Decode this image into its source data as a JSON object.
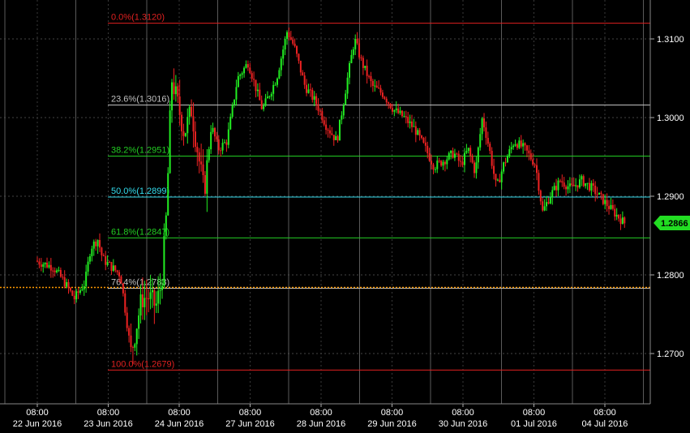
{
  "chart_data": {
    "type": "candlestick",
    "ylim": [
      1.2645,
      1.316
    ],
    "y_ticks": [
      {
        "label": "1.2700",
        "value": 1.27
      },
      {
        "label": "1.2800",
        "value": 1.28
      },
      {
        "label": "1.2900",
        "value": 1.29
      },
      {
        "label": "1.3000",
        "value": 1.3
      },
      {
        "label": "1.3100",
        "value": 1.31
      }
    ],
    "x_ticks": [
      {
        "time": "08:00",
        "date": "22 Jun 2016",
        "day": 0
      },
      {
        "time": "08:00",
        "date": "23 Jun 2016",
        "day": 1
      },
      {
        "time": "08:00",
        "date": "24 Jun 2016",
        "day": 2
      },
      {
        "time": "08:00",
        "date": "27 Jun 2016",
        "day": 3
      },
      {
        "time": "08:00",
        "date": "28 Jun 2016",
        "day": 4
      },
      {
        "time": "08:00",
        "date": "29 Jun 2016",
        "day": 5
      },
      {
        "time": "08:00",
        "date": "30 Jun 2016",
        "day": 6
      },
      {
        "time": "08:00",
        "date": "01 Jul 2016",
        "day": 7
      },
      {
        "time": "08:00",
        "date": "04 Jul 2016",
        "day": 8
      }
    ],
    "fib_levels": [
      {
        "label": "0.0%(1.3120)",
        "value": 1.312,
        "color": "#e02020"
      },
      {
        "label": "23.6%(1.3016)",
        "value": 1.3016,
        "color": "#c0c0c0"
      },
      {
        "label": "38.2%(1.2951)",
        "value": 1.2951,
        "color": "#22cc22"
      },
      {
        "label": "50.0%(1.2899)",
        "value": 1.2899,
        "color": "#33ddee"
      },
      {
        "label": "61.8%(1.2847)",
        "value": 1.2847,
        "color": "#22cc22"
      },
      {
        "label": "76.4%(1.2783)",
        "value": 1.2783,
        "color": "#c0c0c0"
      },
      {
        "label": "100.0%(1.2679)",
        "value": 1.2679,
        "color": "#e02020"
      }
    ],
    "current_price": {
      "label": "1.2866",
      "value": 1.2866,
      "color": "#22dd22"
    },
    "reference_line": {
      "value": 1.2784,
      "color": "#ff9900"
    },
    "up_color": "#22ee22",
    "down_color": "#ee2222",
    "series_anchors": [
      [
        0.0,
        1.2818
      ],
      [
        0.25,
        1.281
      ],
      [
        0.4,
        1.2792
      ],
      [
        0.55,
        1.277
      ],
      [
        0.7,
        1.279
      ],
      [
        0.78,
        1.2835
      ],
      [
        0.88,
        1.2845
      ],
      [
        0.95,
        1.282
      ],
      [
        1.05,
        1.2812
      ],
      [
        1.2,
        1.28
      ],
      [
        1.35,
        1.27
      ],
      [
        1.5,
        1.277
      ],
      [
        1.6,
        1.2772
      ],
      [
        1.7,
        1.276
      ],
      [
        1.78,
        1.279
      ],
      [
        1.85,
        1.288
      ],
      [
        1.92,
        1.305
      ],
      [
        2.0,
        1.302
      ],
      [
        2.1,
        1.298
      ],
      [
        2.2,
        1.301
      ],
      [
        2.3,
        1.295
      ],
      [
        2.38,
        1.2905
      ],
      [
        2.48,
        1.299
      ],
      [
        2.58,
        1.296
      ],
      [
        2.7,
        1.297
      ],
      [
        2.85,
        1.305
      ],
      [
        3.0,
        1.307
      ],
      [
        3.2,
        1.301
      ],
      [
        3.4,
        1.305
      ],
      [
        3.55,
        1.311
      ],
      [
        3.65,
        1.309
      ],
      [
        3.8,
        1.304
      ],
      [
        3.95,
        1.302
      ],
      [
        4.1,
        1.299
      ],
      [
        4.25,
        1.297
      ],
      [
        4.4,
        1.305
      ],
      [
        4.5,
        1.31
      ],
      [
        4.6,
        1.307
      ],
      [
        4.75,
        1.304
      ],
      [
        4.9,
        1.303
      ],
      [
        5.05,
        1.301
      ],
      [
        5.2,
        1.3
      ],
      [
        5.35,
        1.2985
      ],
      [
        5.5,
        1.296
      ],
      [
        5.62,
        1.2938
      ],
      [
        5.75,
        1.2945
      ],
      [
        5.9,
        1.2955
      ],
      [
        6.0,
        1.294
      ],
      [
        6.1,
        1.296
      ],
      [
        6.2,
        1.293
      ],
      [
        6.3,
        1.3
      ],
      [
        6.4,
        1.296
      ],
      [
        6.5,
        1.291
      ],
      [
        6.6,
        1.294
      ],
      [
        6.75,
        1.297
      ],
      [
        6.9,
        1.296
      ],
      [
        7.05,
        1.294
      ],
      [
        7.15,
        1.288
      ],
      [
        7.25,
        1.29
      ],
      [
        7.4,
        1.292
      ],
      [
        7.55,
        1.291
      ],
      [
        7.7,
        1.292
      ],
      [
        7.85,
        1.291
      ],
      [
        8.0,
        1.2895
      ],
      [
        8.15,
        1.288
      ],
      [
        8.3,
        1.2866
      ]
    ]
  }
}
